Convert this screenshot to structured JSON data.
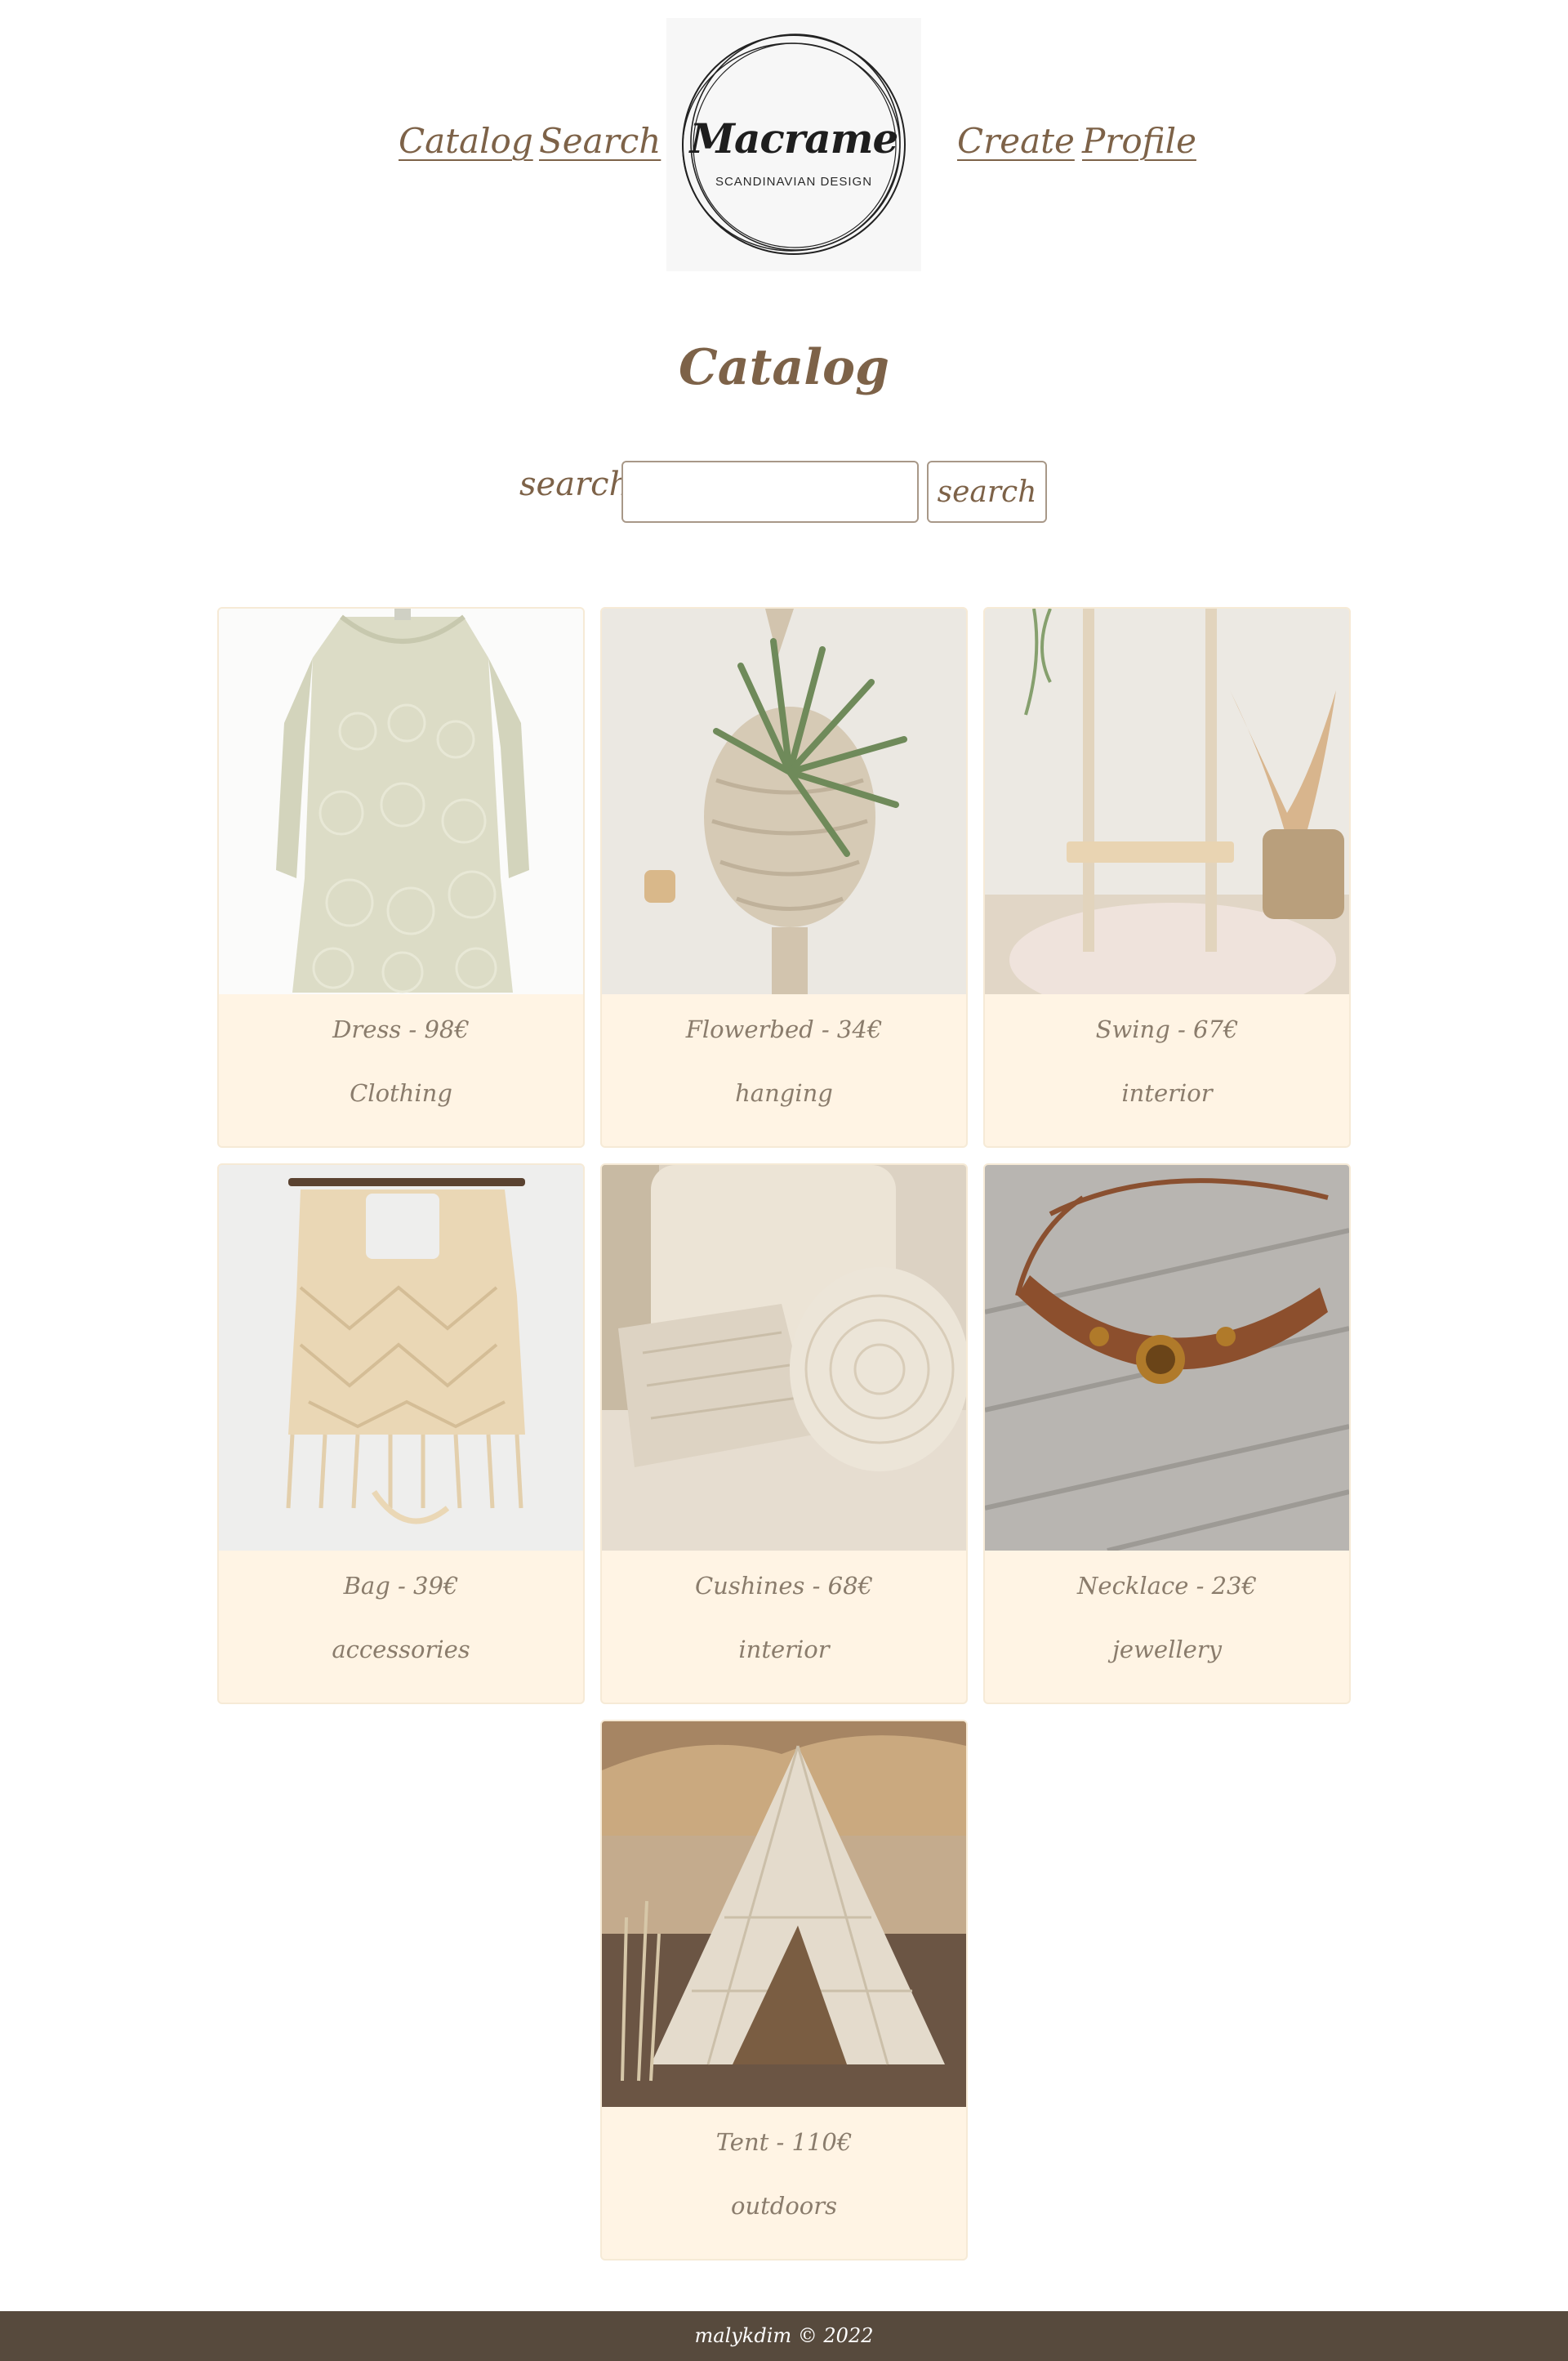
{
  "nav": {
    "catalog_label": "Catalog",
    "search_label": "Search",
    "create_label": "Create",
    "profile_label": "Profile",
    "logo_title": "Macrame",
    "logo_subtitle": "SCANDINAVIAN DESIGN"
  },
  "page_title": "Catalog",
  "search": {
    "label": "search:",
    "input_value": "",
    "button_label": "search"
  },
  "products": [
    {
      "name": "Dress - 98€",
      "category": "Clothing",
      "icon": "dress-photo"
    },
    {
      "name": "Flowerbed - 34€",
      "category": "hanging",
      "icon": "hanging-planter-photo"
    },
    {
      "name": "Swing - 67€",
      "category": "interior",
      "icon": "swing-photo"
    },
    {
      "name": "Bag - 39€",
      "category": "accessories",
      "icon": "bag-photo"
    },
    {
      "name": "Cushines - 68€",
      "category": "interior",
      "icon": "cushions-photo"
    },
    {
      "name": "Necklace - 23€",
      "category": "jewellery",
      "icon": "necklace-photo"
    },
    {
      "name": "Tent - 110€",
      "category": "outdoors",
      "icon": "tent-photo"
    }
  ],
  "footer": {
    "text": "malykdim © 2022"
  },
  "colors": {
    "accent_text": "#7d6248",
    "card_background": "#fff4e4",
    "footer_background": "#574a3d"
  }
}
